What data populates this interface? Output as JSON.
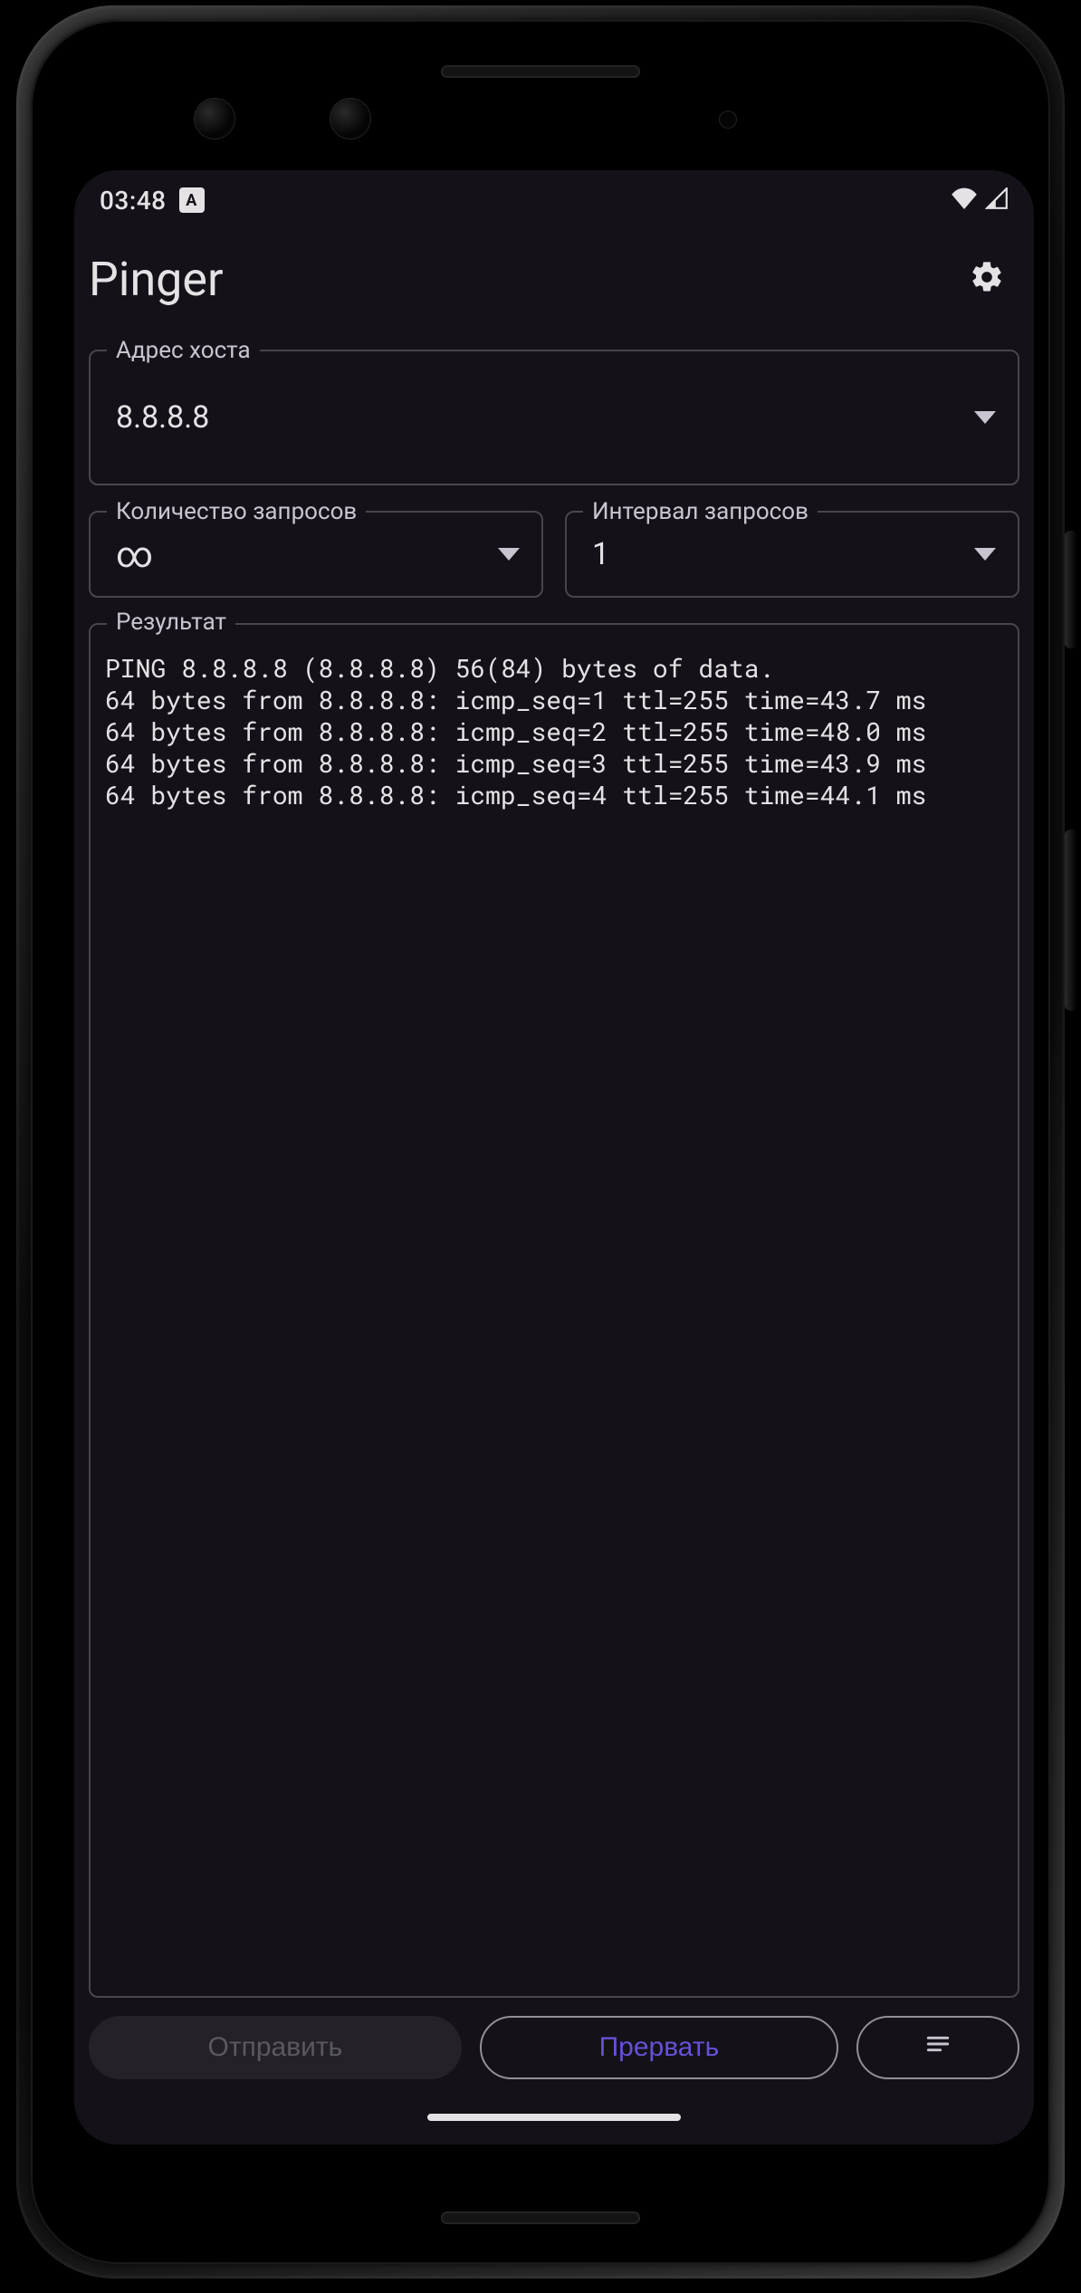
{
  "statusbar": {
    "time": "03:48",
    "lang_badge": "A"
  },
  "appbar": {
    "title": "Pinger"
  },
  "host": {
    "label": "Адрес хоста",
    "value": "8.8.8.8"
  },
  "count": {
    "label": "Количество запросов",
    "value": "∞"
  },
  "interval": {
    "label": "Интервал запросов",
    "value": "1"
  },
  "result": {
    "label": "Результат",
    "lines": [
      "PING 8.8.8.8 (8.8.8.8) 56(84) bytes of data.",
      "64 bytes from 8.8.8.8: icmp_seq=1 ttl=255 time=43.7 ms",
      "64 bytes from 8.8.8.8: icmp_seq=2 ttl=255 time=48.0 ms",
      "64 bytes from 8.8.8.8: icmp_seq=3 ttl=255 time=43.9 ms",
      "64 bytes from 8.8.8.8: icmp_seq=4 ttl=255 time=44.1 ms"
    ]
  },
  "buttons": {
    "send": "Отправить",
    "abort": "Прервать"
  },
  "colors": {
    "surface": "#141218",
    "outline": "#49454f",
    "on_surface": "#e6e1e5",
    "on_surface_variant": "#cac4d0",
    "accent": "#6750d8"
  }
}
